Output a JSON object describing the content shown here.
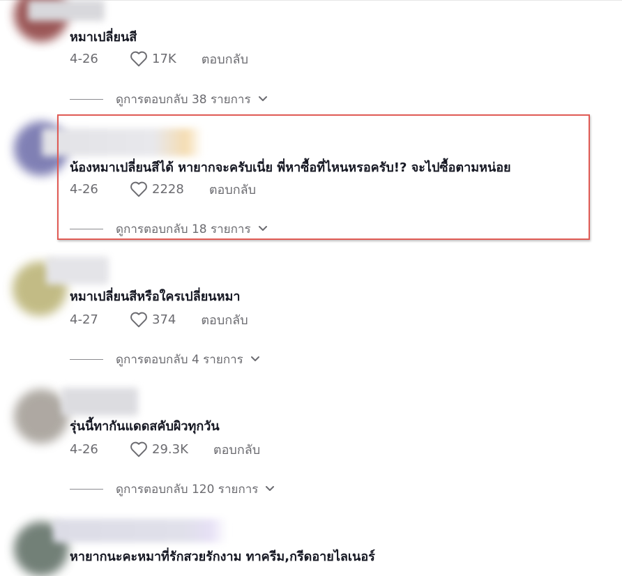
{
  "comments": [
    {
      "text": "หมาเปลี่ยนสี",
      "date": "4-26",
      "likes": "17K",
      "reply": "ตอบกลับ",
      "view_replies": "ดูการตอบกลับ 38 รายการ"
    },
    {
      "text": "น้องหมาเปลี่ยนสีได้ หายากจะครับเนี่ย พี่หาซื้อที่ไหนหรอครับ!? จะไปซื้อตามหน่อย",
      "date": "4-26",
      "likes": "2228",
      "reply": "ตอบกลับ",
      "view_replies": "ดูการตอบกลับ 18 รายการ"
    },
    {
      "text": "หมาเปลี่ยนสีหรือใครเปลี่ยนหมา",
      "date": "4-27",
      "likes": "374",
      "reply": "ตอบกลับ",
      "view_replies": "ดูการตอบกลับ 4 รายการ"
    },
    {
      "text": "รุ่นนี้ทากันแดดสคับผิวทุกวัน",
      "date": "4-26",
      "likes": "29.3K",
      "reply": "ตอบกลับ",
      "view_replies": "ดูการตอบกลับ 120 รายการ"
    },
    {
      "text": "หายากนะคะหมาที่รักสวยรักงาม ทาครีม,กรีดอายไลเนอร์"
    }
  ],
  "icons": {
    "like": "heart-outline-icon",
    "expand": "chevron-down-icon"
  },
  "colors": {
    "highlight_border": "#e05a54",
    "muted_text": "#6b6b70",
    "primary_text": "#161823"
  }
}
